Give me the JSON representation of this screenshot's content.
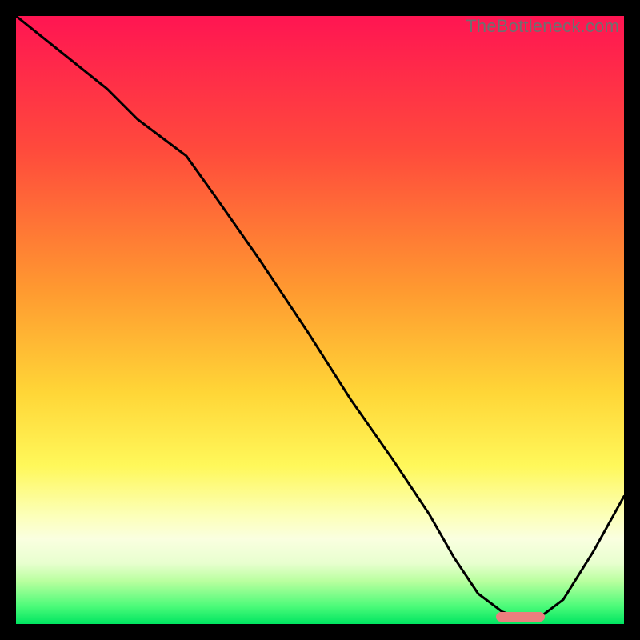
{
  "watermark": "TheBottleneck.com",
  "colors": {
    "frame": "#000000",
    "line": "#000000",
    "marker": "#eb7e7e",
    "gradient_stops": [
      {
        "offset": "0%",
        "color": "#ff1552"
      },
      {
        "offset": "22%",
        "color": "#ff4a3c"
      },
      {
        "offset": "45%",
        "color": "#ff9930"
      },
      {
        "offset": "62%",
        "color": "#ffd637"
      },
      {
        "offset": "74%",
        "color": "#fff85a"
      },
      {
        "offset": "82%",
        "color": "#fcffb7"
      },
      {
        "offset": "86%",
        "color": "#faffe0"
      },
      {
        "offset": "90%",
        "color": "#e8ffcf"
      },
      {
        "offset": "93%",
        "color": "#b8ff9e"
      },
      {
        "offset": "97%",
        "color": "#4efb7a"
      },
      {
        "offset": "100%",
        "color": "#00e561"
      }
    ]
  },
  "chart_data": {
    "type": "line",
    "title": "",
    "xlabel": "",
    "ylabel": "",
    "xlim": [
      0,
      1
    ],
    "ylim": [
      0,
      1
    ],
    "x": [
      0.0,
      0.05,
      0.1,
      0.15,
      0.2,
      0.24,
      0.28,
      0.33,
      0.4,
      0.48,
      0.55,
      0.62,
      0.68,
      0.72,
      0.76,
      0.8,
      0.83,
      0.86,
      0.9,
      0.95,
      1.0
    ],
    "values": [
      1.0,
      0.96,
      0.92,
      0.88,
      0.83,
      0.8,
      0.77,
      0.7,
      0.6,
      0.48,
      0.37,
      0.27,
      0.18,
      0.11,
      0.05,
      0.02,
      0.01,
      0.01,
      0.04,
      0.12,
      0.21
    ],
    "annotations": [
      {
        "type": "marker",
        "x_range": [
          0.79,
          0.87
        ],
        "y": 0.012
      }
    ]
  }
}
